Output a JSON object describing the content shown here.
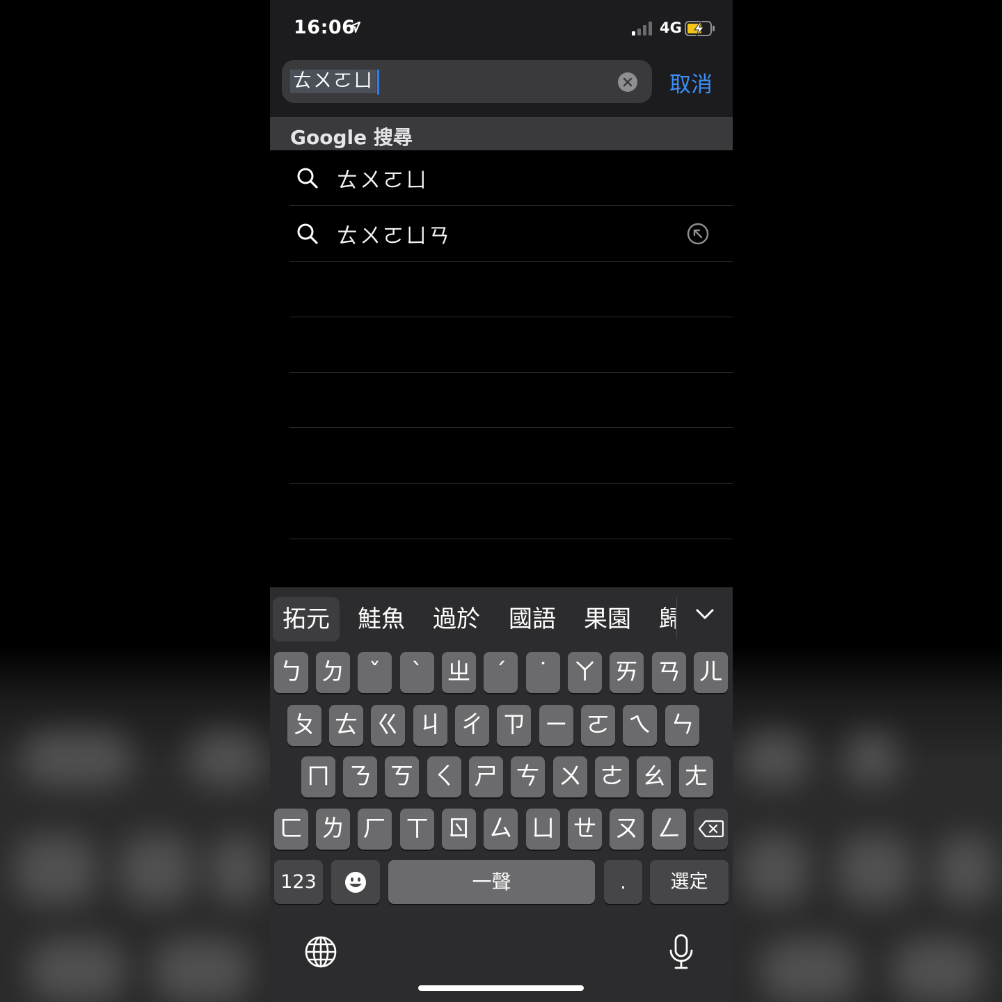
{
  "status_bar": {
    "time": "16:06",
    "network": "4G"
  },
  "search": {
    "query": "ㄊㄨㄛㄩ",
    "cancel_label": "取消"
  },
  "results": {
    "section_title": "Google 搜尋",
    "suggestions": [
      "ㄊㄨㄛㄩ",
      "ㄊㄨㄛㄩㄢ"
    ]
  },
  "keyboard": {
    "candidates": [
      "拓元",
      "鮭魚",
      "過於",
      "國語",
      "果園",
      "歸"
    ],
    "row1": [
      "ㄅ",
      "ㄉ",
      "ˇ",
      "ˋ",
      "ㄓ",
      "ˊ",
      "˙",
      "ㄚ",
      "ㄞ",
      "ㄢ",
      "ㄦ"
    ],
    "row2": [
      "ㄆ",
      "ㄊ",
      "ㄍ",
      "ㄐ",
      "ㄔ",
      "ㄗ",
      "ㄧ",
      "ㄛ",
      "ㄟ",
      "ㄣ"
    ],
    "row3": [
      "ㄇ",
      "ㄋ",
      "ㄎ",
      "ㄑ",
      "ㄕ",
      "ㄘ",
      "ㄨ",
      "ㄜ",
      "ㄠ",
      "ㄤ"
    ],
    "row4": [
      "ㄈ",
      "ㄌ",
      "ㄏ",
      "ㄒ",
      "ㄖ",
      "ㄙ",
      "ㄩ",
      "ㄝ",
      "ㄡ",
      "ㄥ"
    ],
    "numbers_label": "123",
    "space_label": "一聲",
    "period_label": ".",
    "select_label": "選定"
  },
  "colors": {
    "accent": "#3b8ef6",
    "caret": "#2f7bf5",
    "keyboard_bg": "#2c2c2e",
    "key_bg": "#6b6b6d"
  }
}
